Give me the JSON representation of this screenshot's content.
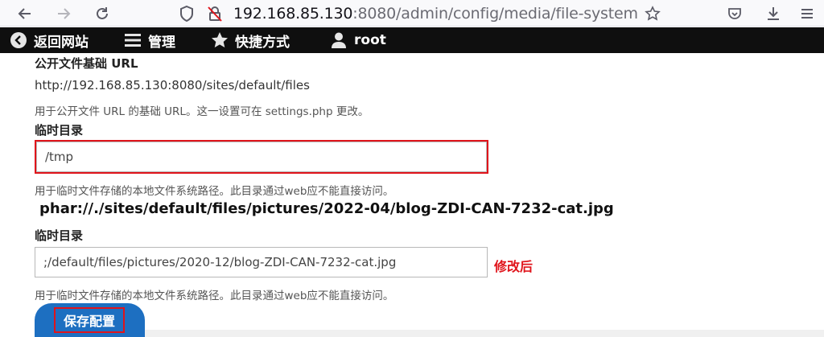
{
  "browser": {
    "url_host": "192.168.85.130",
    "url_rest": ":8080/admin/config/media/file-system",
    "icons": [
      "back-icon",
      "forward-icon",
      "reload-icon",
      "shield-icon",
      "insecure-lock-icon",
      "bookmark-star-icon",
      "pocket-icon",
      "download-icon",
      "menu-icon"
    ]
  },
  "toolbar": {
    "back_label": "返回网站",
    "manage_label": "管理",
    "shortcuts_label": "快捷方式",
    "user_label": "root"
  },
  "form": {
    "public_url_label": "公开文件基础 URL",
    "public_url_value": "http://192.168.85.130:8080/sites/default/files",
    "public_url_desc": "用于公开文件 URL 的基础 URL。这一设置可在 settings.php 更改。",
    "temp_label_1": "临时目录",
    "temp_value_1": "/tmp",
    "temp_desc_1": "用于临时文件存储的本地文件系统路径。此目录通过web应不能直接访问。",
    "phar_text": "phar://./sites/default/files/pictures/2022-04/blog-ZDI-CAN-7232-cat.jpg",
    "temp_label_2": "临时目录",
    "temp_value_2": ";/default/files/pictures/2020-12/blog-ZDI-CAN-7232-cat.jpg",
    "modified_note": "修改后",
    "temp_desc_2": "用于临时文件存储的本地文件系统路径。此目录通过web应不能直接访问。",
    "save_label": "保存配置"
  },
  "colors": {
    "highlight": "#e0141b",
    "toolbar_bg": "#0f0f0f",
    "button_bg": "#1d6fc1"
  }
}
